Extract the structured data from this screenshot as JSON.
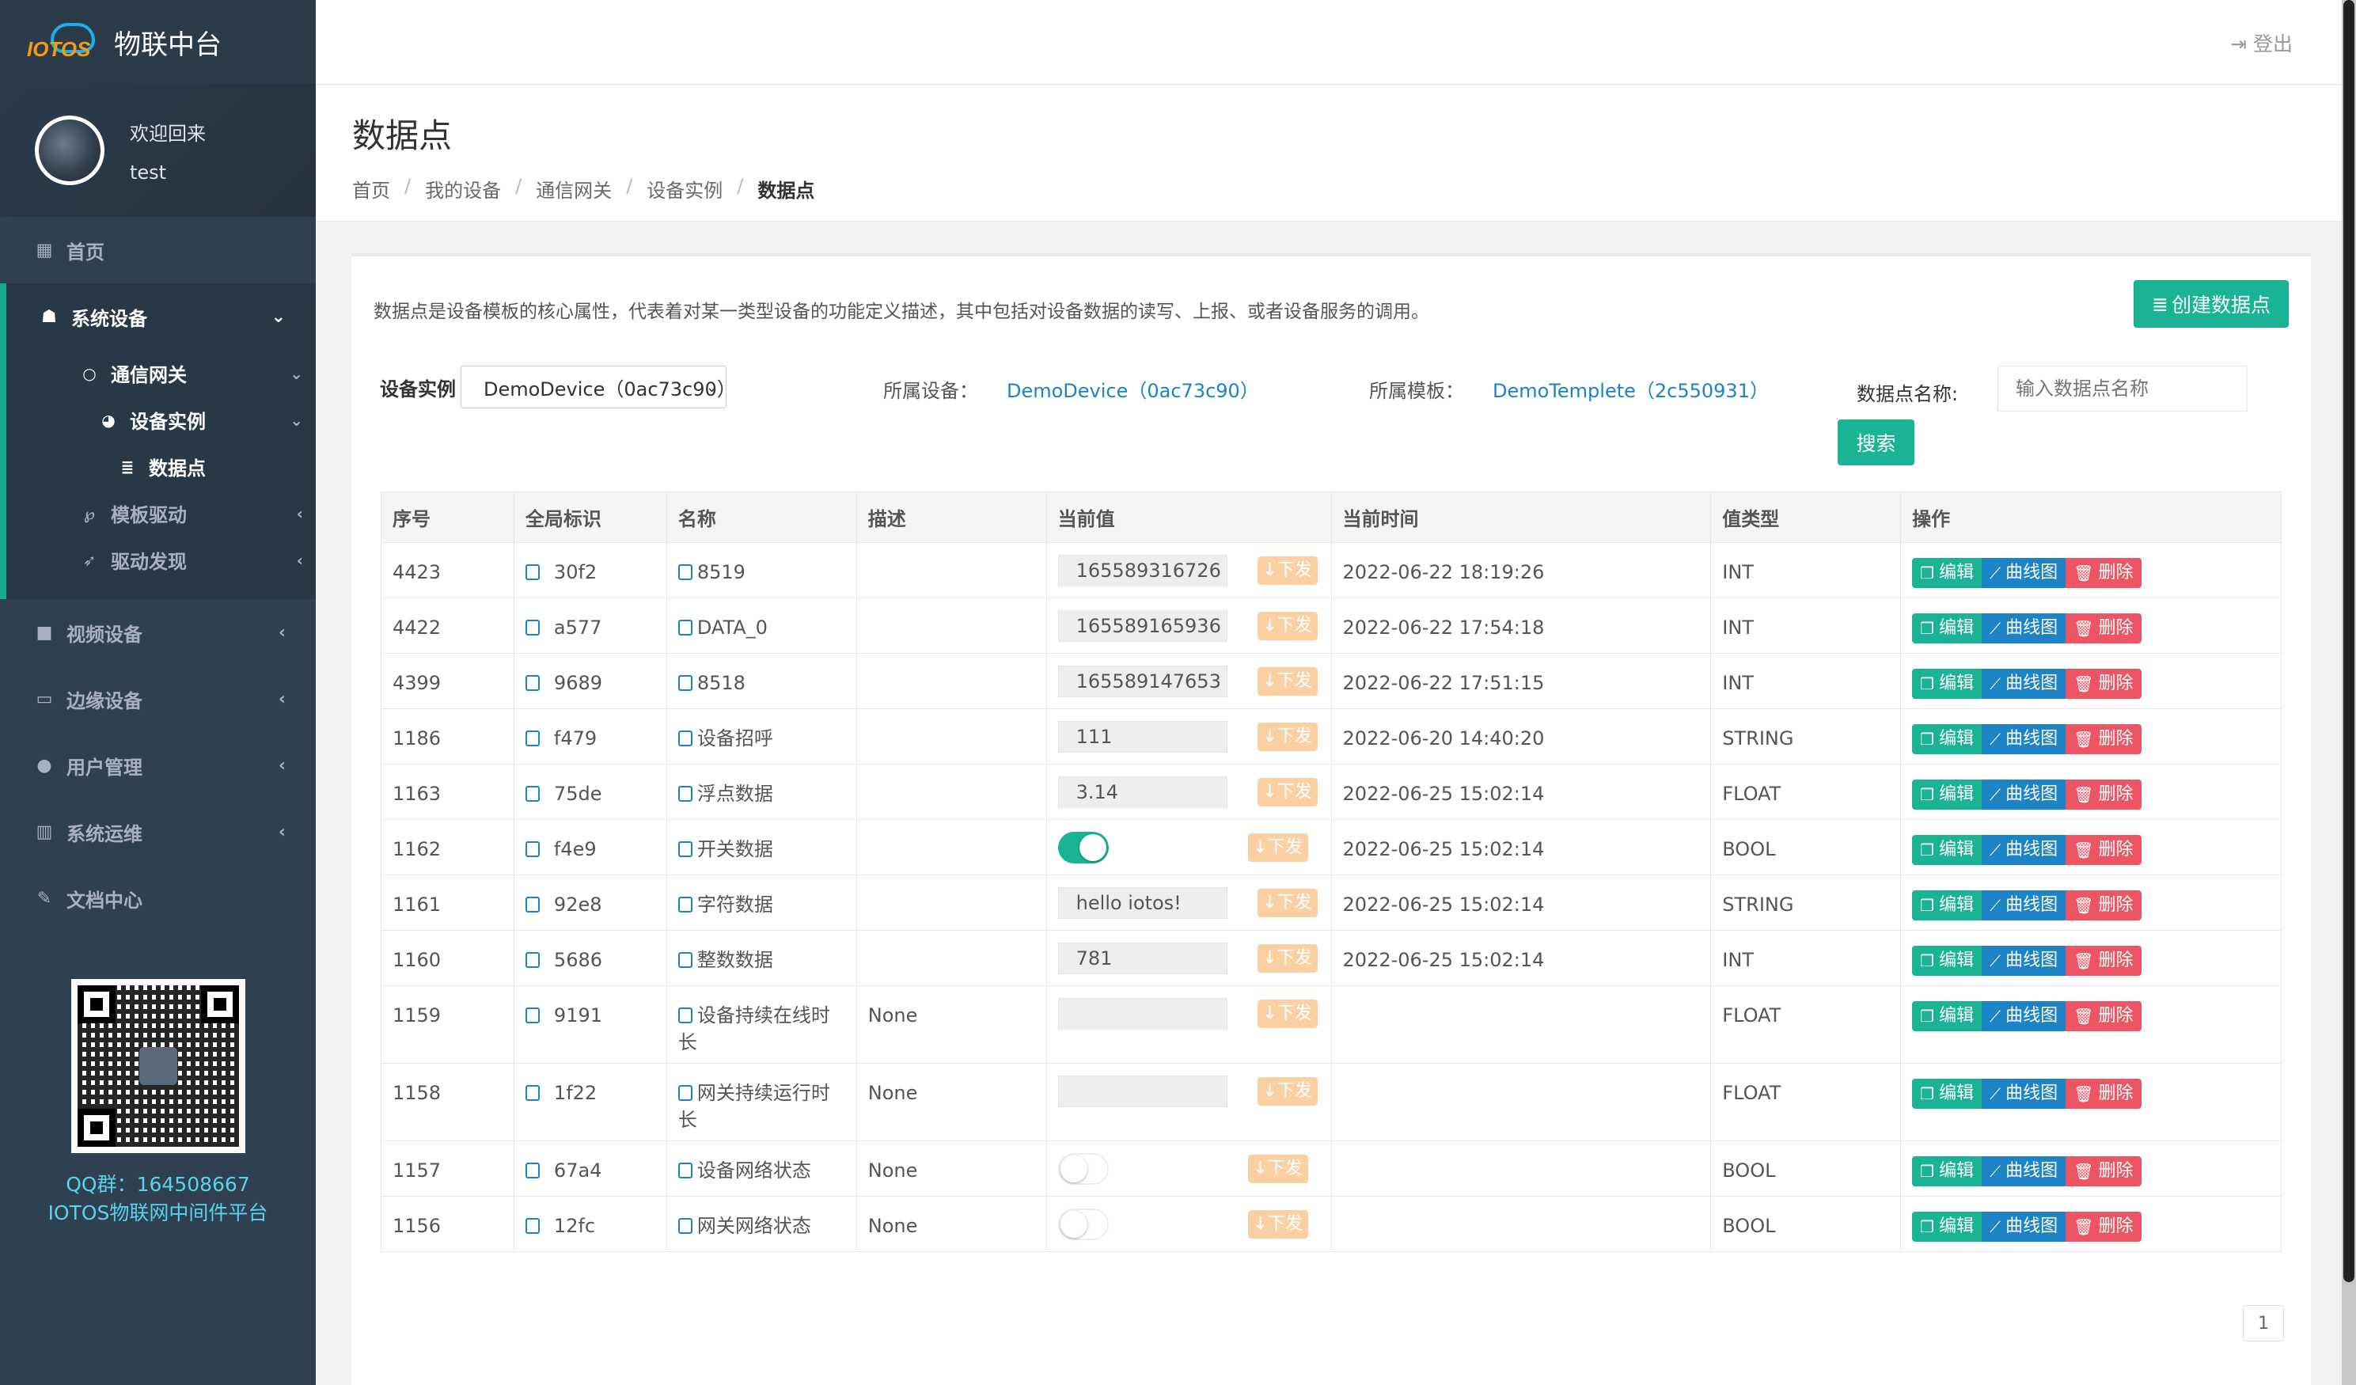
{
  "brand": {
    "logo_text": "IOTOS",
    "title": "物联中台"
  },
  "profile": {
    "welcome": "欢迎回来",
    "username": "test"
  },
  "nav": {
    "home": "首页",
    "system_devices": "系统设备",
    "gateway": "通信网关",
    "device_instance": "设备实例",
    "data_points": "数据点",
    "template_driver": "模板驱动",
    "driver_discovery": "驱动发现",
    "video_devices": "视频设备",
    "edge_devices": "边缘设备",
    "user_management": "用户管理",
    "ops": "系统运维",
    "docs": "文档中心"
  },
  "qr": {
    "line1": "QQ群：164508667",
    "line2": "IOTOS物联网中间件平台"
  },
  "topbar": {
    "logout": "登出"
  },
  "page": {
    "title": "数据点",
    "breadcrumb": [
      "首页",
      "我的设备",
      "通信网关",
      "设备实例",
      "数据点"
    ]
  },
  "panel": {
    "description": "数据点是设备模板的核心属性，代表着对某一类型设备的功能定义描述，其中包括对设备数据的读写、上报、或者设备服务的调用。",
    "create_button": "创建数据点"
  },
  "filters": {
    "instance_label": "设备实例",
    "instance_value": "DemoDevice（0ac73c90）",
    "device_label": "所属设备：",
    "device_link": "DemoDevice（0ac73c90）",
    "template_label": "所属模板：",
    "template_link": "DemoTemplete（2c550931）",
    "name_label": "数据点名称:",
    "name_placeholder": "输入数据点名称",
    "search_button": "搜索"
  },
  "table": {
    "columns": [
      "序号",
      "全局标识",
      "名称",
      "描述",
      "当前值",
      "当前时间",
      "值类型",
      "操作"
    ],
    "send_label": "下发",
    "ops": {
      "edit": "编辑",
      "chart": "曲线图",
      "delete": "删除"
    },
    "rows": [
      {
        "id": "4423",
        "gid": "30f2",
        "name": "8519",
        "desc": "",
        "value": "165589316726",
        "kind": "text",
        "time": "2022-06-22 18:19:26",
        "type": "INT"
      },
      {
        "id": "4422",
        "gid": "a577",
        "name": "DATA_0",
        "desc": "",
        "value": "165589165936",
        "kind": "text",
        "time": "2022-06-22 17:54:18",
        "type": "INT"
      },
      {
        "id": "4399",
        "gid": "9689",
        "name": "8518",
        "desc": "",
        "value": "165589147653",
        "kind": "text",
        "time": "2022-06-22 17:51:15",
        "type": "INT"
      },
      {
        "id": "1186",
        "gid": "f479",
        "name": "设备招呼",
        "desc": "",
        "value": "111",
        "kind": "text",
        "time": "2022-06-20 14:40:20",
        "type": "STRING"
      },
      {
        "id": "1163",
        "gid": "75de",
        "name": "浮点数据",
        "desc": "",
        "value": "3.14",
        "kind": "text",
        "time": "2022-06-25 15:02:14",
        "type": "FLOAT"
      },
      {
        "id": "1162",
        "gid": "f4e9",
        "name": "开关数据",
        "desc": "",
        "value": "on",
        "kind": "toggle",
        "time": "2022-06-25 15:02:14",
        "type": "BOOL"
      },
      {
        "id": "1161",
        "gid": "92e8",
        "name": "字符数据",
        "desc": "",
        "value": "hello iotos!",
        "kind": "text",
        "time": "2022-06-25 15:02:14",
        "type": "STRING"
      },
      {
        "id": "1160",
        "gid": "5686",
        "name": "整数数据",
        "desc": "",
        "value": "781",
        "kind": "text",
        "time": "2022-06-25 15:02:14",
        "type": "INT"
      },
      {
        "id": "1159",
        "gid": "9191",
        "name": "设备持续在线时长",
        "desc": "None",
        "value": "",
        "kind": "text",
        "time": "",
        "type": "FLOAT"
      },
      {
        "id": "1158",
        "gid": "1f22",
        "name": "网关持续运行时长",
        "desc": "None",
        "value": "",
        "kind": "text",
        "time": "",
        "type": "FLOAT"
      },
      {
        "id": "1157",
        "gid": "67a4",
        "name": "设备网络状态",
        "desc": "None",
        "value": "off",
        "kind": "toggle",
        "time": "",
        "type": "BOOL"
      },
      {
        "id": "1156",
        "gid": "12fc",
        "name": "网关网络状态",
        "desc": "None",
        "value": "off",
        "kind": "toggle",
        "time": "",
        "type": "BOOL"
      }
    ]
  },
  "pagination": {
    "current": "1"
  },
  "colors": {
    "sidebar": "#2f4050",
    "primary": "#1ab394",
    "info": "#1c84c6",
    "danger": "#ed5565",
    "warning": "#f8ac59"
  }
}
